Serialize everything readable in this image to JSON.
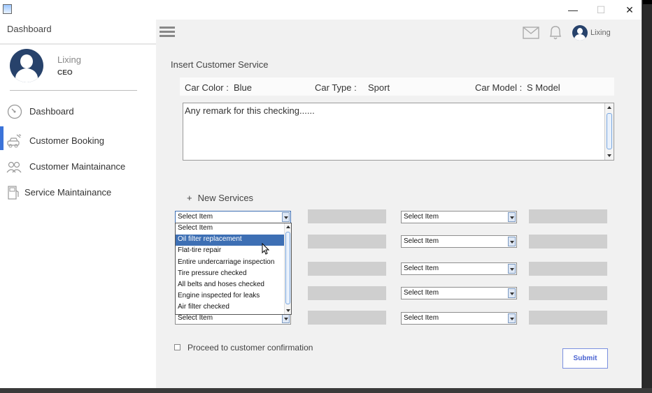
{
  "window": {
    "minimize": "—",
    "maximize": "☐",
    "close": "✕"
  },
  "sidebar": {
    "title": "Dashboard",
    "user": {
      "name": "Lixing",
      "role": "CEO"
    },
    "items": [
      {
        "label": "Dashboard",
        "icon": "speedometer-icon"
      },
      {
        "label": "Customer Booking",
        "icon": "car-service-icon",
        "active": true
      },
      {
        "label": "Customer Maintainance",
        "icon": "users-icon"
      },
      {
        "label": "Service Maintainance",
        "icon": "fuel-pump-icon"
      }
    ]
  },
  "header": {
    "user_name": "Lixing",
    "icons": [
      "menu-icon",
      "mail-icon",
      "bell-icon",
      "avatar"
    ]
  },
  "main": {
    "section_title": "Insert Customer Service",
    "car_color_label": "Car Color :",
    "car_color_value": "Blue",
    "car_type_label": "Car Type :",
    "car_type_value": "Sport",
    "car_model_label": "Car Model :",
    "car_model_value": "S Model",
    "remark_placeholder": "Any remark for this checking......",
    "new_services_plus": "+",
    "new_services_label": "New Services",
    "combo_text": "Select Item",
    "dropdown_items": [
      "Select Item",
      "Oil filter replacement",
      "Flat-tire repair",
      "Entire undercarriage inspection",
      "Tire pressure checked",
      "All belts and hoses checked",
      "Engine inspected for leaks",
      "Air filter checked"
    ],
    "dropdown_selected_index": 1,
    "proceed_label": "Proceed to customer confirmation",
    "proceed_checked": false,
    "submit_label": "Submit"
  },
  "colors": {
    "accent": "#3b73d9",
    "submit_text": "#4a63d1",
    "selection": "#3d6fb4"
  }
}
